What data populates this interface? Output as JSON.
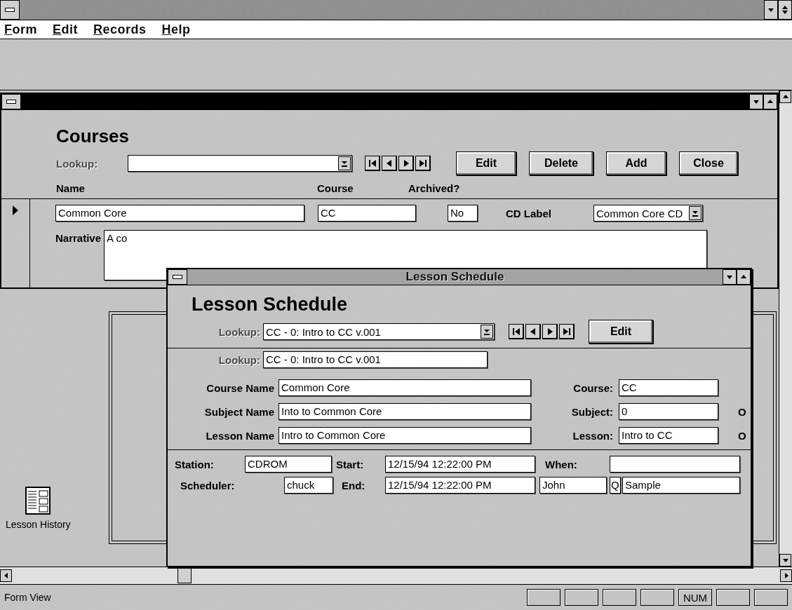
{
  "menu": [
    {
      "label": "Form"
    },
    {
      "label": "Edit"
    },
    {
      "label": "Records"
    },
    {
      "label": "Help"
    }
  ],
  "courses": {
    "heading": "Courses",
    "lookup_label": "Lookup:",
    "buttons": [
      "Edit",
      "Delete",
      "Add",
      "Close"
    ],
    "columns": [
      "Name",
      "Course",
      "Archived?"
    ],
    "record": {
      "current": true,
      "name": "Common Core",
      "course": "CC",
      "archived": "No",
      "cd_label_label": "CD Label",
      "cd_label": "Common Core CD",
      "narrative_label": "Narrative",
      "narrative": "A co"
    }
  },
  "lesson_schedule": {
    "window_title": "Lesson Schedule",
    "heading": "Lesson Schedule",
    "lookup_label": "Lookup:",
    "lookup_value": "CC - 0: Intro to CC v.001",
    "buttons": [
      "Edit"
    ],
    "lookup2_label": "Lookup:",
    "lookup2_value": "CC - 0: Intro to CC v.001",
    "rows": [
      {
        "label": "Course Name",
        "value": "Common Core",
        "right_label": "Course:",
        "right_value": "CC"
      },
      {
        "label": "Subject Name",
        "value": "Into to Common Core",
        "right_label": "Subject:",
        "right_value": "0",
        "cut": "O"
      },
      {
        "label": "Lesson Name",
        "value": "Intro to Common Core",
        "right_label": "Lesson:",
        "right_value": "Intro to CC",
        "cut": "O"
      }
    ],
    "station_label": "Station:",
    "station": "CDROM",
    "start_label": "Start:",
    "start": "12/15/94 12:22:00 PM",
    "when_label": "When:",
    "scheduler_label": "Scheduler:",
    "scheduler": "chuck",
    "end_label": "End:",
    "end": "12/15/94 12:22:00 PM",
    "first_name": "John",
    "initial": "Q",
    "last_name": "Sample"
  },
  "desktop_icon": {
    "label": "Lesson History"
  },
  "status_bar": {
    "text": "Form View",
    "num_indicator": "NUM"
  }
}
